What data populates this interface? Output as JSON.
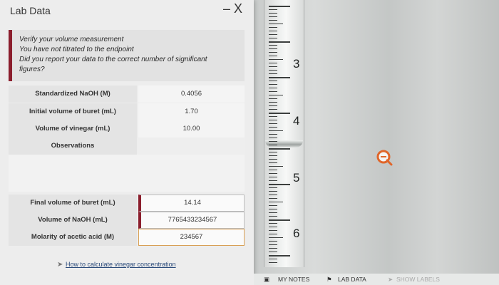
{
  "window": {
    "title": "Lab Data",
    "close_label": "– X"
  },
  "feedback": {
    "lines": [
      "Verify your volume measurement",
      "You have not titrated to the endpoint",
      "Did you report your data to the correct number of significant",
      "figures?"
    ],
    "accent_color": "#8b1e2d"
  },
  "data_table": {
    "rows": [
      {
        "label": "Standardized NaOH (M)",
        "value": "0.4056"
      },
      {
        "label": "Initial volume of buret (mL)",
        "value": "1.70"
      },
      {
        "label": "Volume of vinegar (mL)",
        "value": "10.00"
      }
    ],
    "observations_label": "Observations"
  },
  "inputs": {
    "rows": [
      {
        "label": "Final volume of buret (mL)",
        "value": "14.14",
        "state": "error"
      },
      {
        "label": "Volume of NaOH (mL)",
        "value": "7765433234567",
        "state": "error"
      },
      {
        "label": "Molarity of acetic acid (M)",
        "value": "234567",
        "state": "warning"
      }
    ]
  },
  "help_link": "How to calculate vinegar concentration",
  "burette": {
    "numbers": [
      "3",
      "4",
      "5",
      "6"
    ]
  },
  "bottom_bar": {
    "my_notes": "MY NOTES",
    "lab_data": "LAB DATA",
    "show_labels": "SHOW LABELS"
  }
}
